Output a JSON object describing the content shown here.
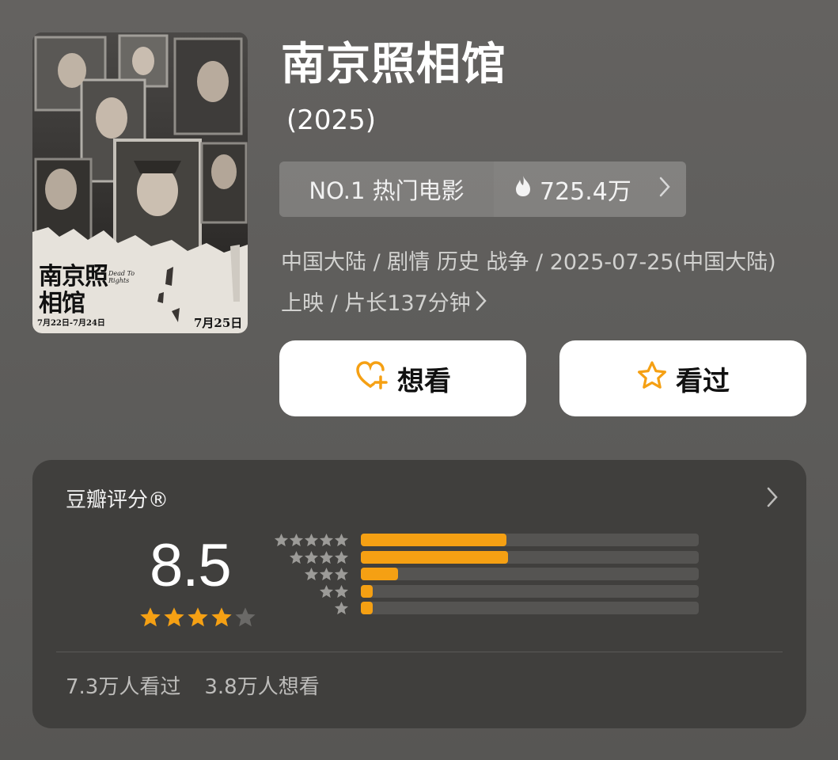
{
  "movie": {
    "title": "南京照相馆",
    "year": "(2025)",
    "poster": {
      "title_art": "南京照相馆",
      "english_title": "Dead To Rights",
      "preview_dates": "7月22日-7月24日",
      "release_date": "7月25日"
    }
  },
  "ranking": {
    "label": "NO.1 热门电影",
    "heat": "725.4万",
    "heat_icon": "flame-icon"
  },
  "info_line": "中国大陆 / 剧情 历史 战争 / 2025-07-25(中国大陆) 上映 / 片长137分钟",
  "actions": {
    "want": {
      "label": "想看",
      "icon": "heart-plus-icon"
    },
    "seen": {
      "label": "看过",
      "icon": "star-outline-icon"
    }
  },
  "rating": {
    "title": "豆瓣评分®",
    "score": "8.5",
    "star_rating": 4.25,
    "distribution": [
      {
        "stars": 5,
        "fraction": 0.43
      },
      {
        "stars": 4,
        "fraction": 0.435
      },
      {
        "stars": 3,
        "fraction": 0.11
      },
      {
        "stars": 2,
        "fraction": 0.035
      },
      {
        "stars": 1,
        "fraction": 0.035
      }
    ],
    "watched": "7.3万人看过",
    "wanted": "3.8万人想看"
  },
  "colors": {
    "accent": "#f5a013",
    "bar_track": "#555452",
    "card_bg": "#403f3d",
    "page_bg": "#5f5e5c"
  }
}
